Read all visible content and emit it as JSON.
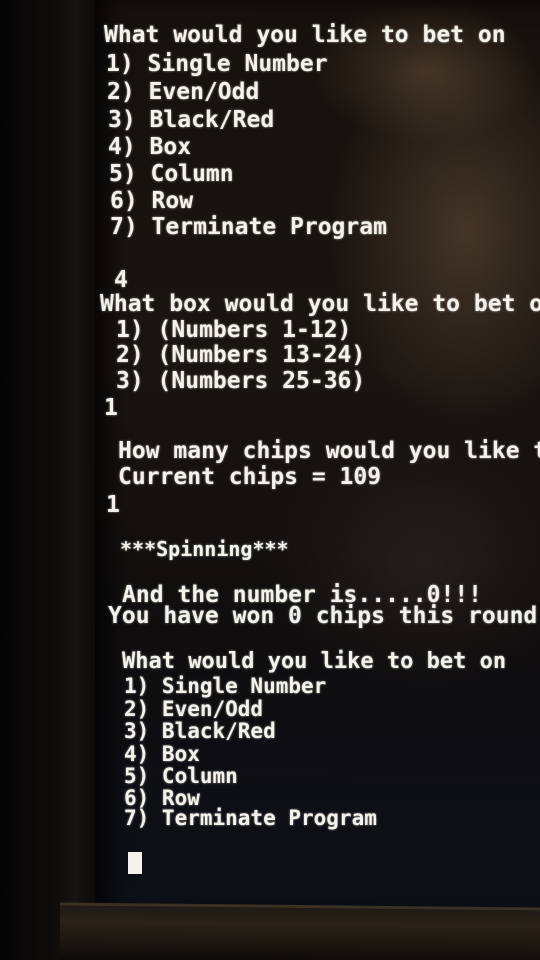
{
  "terminal": {
    "lines": [
      "What would you like to bet on",
      "1) Single Number",
      "2) Even/Odd",
      "3) Black/Red",
      "4) Box",
      "5) Column",
      "6) Row",
      "7) Terminate Program",
      "4",
      "What box would you like to bet on",
      "1) (Numbers 1-12)",
      "2) (Numbers 13-24)",
      "3) (Numbers 25-36)",
      "1",
      "How many chips would you like to",
      "Current chips = 109",
      "1",
      "***Spinning***",
      "And the number is.....0!!!",
      "You have won 0 chips this round",
      "What would you like to bet on",
      "1) Single Number",
      "2) Even/Odd",
      "3) Black/Red",
      "4) Box",
      "5) Column",
      "6) Row",
      "7) Terminate Program"
    ]
  }
}
